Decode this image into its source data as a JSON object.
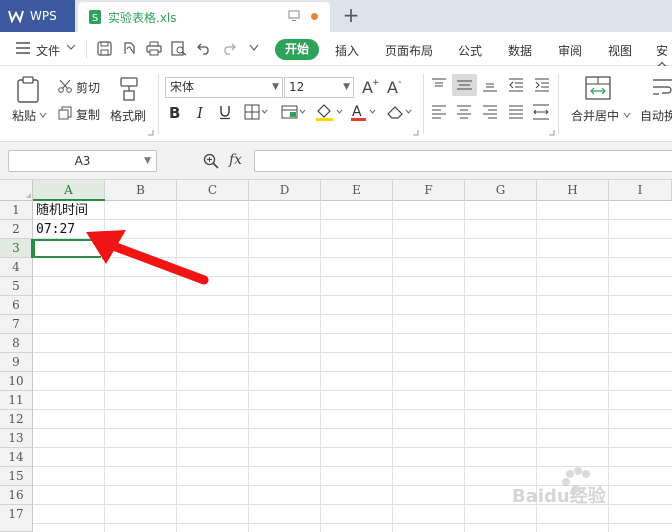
{
  "tabs": {
    "app_name": "WPS",
    "document_name": "实验表格.xls",
    "new_tab_symbol": "+"
  },
  "menu": {
    "file_label": "文件",
    "start_label": "开始",
    "items": [
      "插入",
      "页面布局",
      "公式",
      "数据",
      "审阅",
      "视图",
      "安全"
    ]
  },
  "ribbon": {
    "paste_label": "粘贴",
    "cut_label": "剪切",
    "copy_label": "复制",
    "format_painter_label": "格式刷",
    "font_name": "宋体",
    "font_size": "12",
    "merge_center_label": "合并居中",
    "auto_wrap_label": "自动换",
    "accent_color": "#2ea15a",
    "font_color_bar": "#e53935",
    "fill_color_bar": "#ffd600"
  },
  "formula_bar": {
    "cell_reference": "A3",
    "fx_label": "fx",
    "formula_value": ""
  },
  "sheet": {
    "columns": [
      "A",
      "B",
      "C",
      "D",
      "E",
      "F",
      "G",
      "H",
      "I"
    ],
    "rows": [
      "1",
      "2",
      "3",
      "4",
      "5",
      "6",
      "7",
      "8",
      "9",
      "10",
      "11",
      "12",
      "13",
      "14",
      "15",
      "16",
      "17"
    ],
    "selected_cell": "A3",
    "cells": {
      "A1": "随机时间",
      "A2": "07:27"
    }
  },
  "annotation": {
    "arrow_color": "#f01414"
  },
  "watermark": {
    "text": "Baidu经验"
  }
}
